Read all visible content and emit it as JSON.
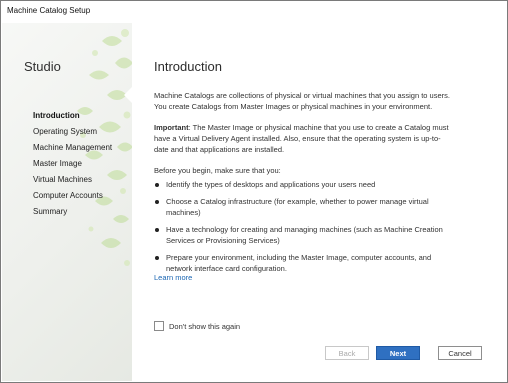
{
  "window": {
    "title": "Machine Catalog Setup"
  },
  "sidebar": {
    "title": "Studio",
    "steps": [
      {
        "label": "Introduction",
        "active": true
      },
      {
        "label": "Operating System"
      },
      {
        "label": "Machine Management"
      },
      {
        "label": "Master Image"
      },
      {
        "label": "Virtual Machines"
      },
      {
        "label": "Computer Accounts"
      },
      {
        "label": "Summary"
      }
    ]
  },
  "main": {
    "heading": "Introduction",
    "intro": "Machine Catalogs are collections of physical or virtual machines that you assign to users. You create Catalogs from Master Images or physical machines in your environment.",
    "important_label": "Important",
    "important_text": ": The Master Image or physical machine that you use to create a Catalog must have a Virtual Delivery Agent installed. Also, ensure that the operating system is up-to-date and that applications are installed.",
    "before": "Before you begin, make sure that you:",
    "bullets": [
      "Identify the types of desktops and applications your users need",
      "Choose a Catalog infrastructure (for example, whether to power manage virtual machines)",
      "Have a technology for creating and managing machines (such as Machine Creation Services or Provisioning Services)",
      "Prepare your environment, including the Master Image, computer accounts, and network interface card configuration."
    ],
    "learn_more": "Learn more",
    "dont_show": "Don't show this again"
  },
  "buttons": {
    "back": "Back",
    "next": "Next",
    "cancel": "Cancel"
  },
  "colors": {
    "accent": "#2f70c1",
    "link": "#1b66b3",
    "pattern": "#9cc25a"
  }
}
